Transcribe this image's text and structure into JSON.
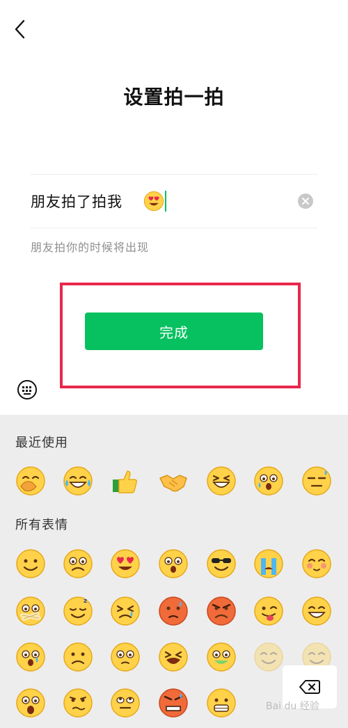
{
  "header": {
    "title": "设置拍一拍"
  },
  "input": {
    "value": "朋友拍了拍我",
    "emoji": "smiling-face-heart-eyes",
    "hint": "朋友拍你的时候将出现"
  },
  "actions": {
    "done_label": "完成"
  },
  "emoji_panel": {
    "recent_label": "最近使用",
    "all_label": "所有表情",
    "recent": [
      "facepalm",
      "tears-of-joy",
      "thumbs-up",
      "handshake",
      "grin-squint",
      "wow-sweat",
      "unamused-sweat"
    ],
    "all": [
      [
        "smile",
        "worried",
        "heart-eyes",
        "stunned",
        "cool",
        "cry-loud",
        "shy"
      ],
      [
        "shush",
        "sleepy",
        "frustrated",
        "awkward",
        "angry",
        "tongue-wink",
        "grin"
      ],
      [
        "scared",
        "frown",
        "pleading",
        "anguish",
        "sick",
        "faded-1",
        "faded-2"
      ],
      [
        "shocked",
        "confused",
        "rolling-eyes",
        "rage",
        "grimace"
      ]
    ]
  },
  "watermark": "Bai du 经验",
  "colors": {
    "accent_green": "#07c160",
    "highlight_red": "#e8284b",
    "panel_bg": "#ededed"
  }
}
